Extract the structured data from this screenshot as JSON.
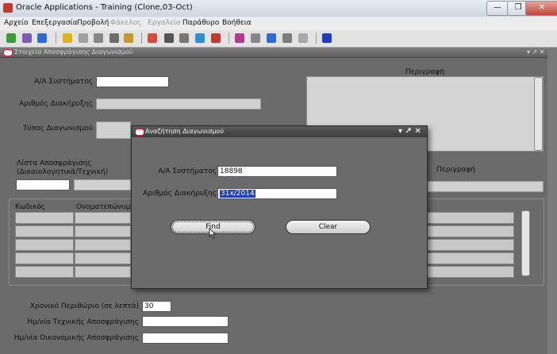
{
  "window": {
    "title": "Oracle Applications - Training (Clone,03-Oct)",
    "min_label": "—",
    "max_label": "❐",
    "close_label": "✕"
  },
  "menubar": {
    "items": [
      "Αρχείο",
      "Επεξεργασία",
      "Προβολή",
      "Φάκελος",
      "Εργαλεία",
      "Παράθυρο",
      "Βοήθεια"
    ]
  },
  "form": {
    "title": "Στοιχεία Αποσφράγισης Διαγωνισμού",
    "controls": "▾ ↗ ✕",
    "system_id_label": "Α/Α Συστήματος",
    "announcement_label": "Αριθμός Διακήρυξης",
    "type_label": "Τύπος Διαγωνισμού",
    "description_label": "Περιγραφή",
    "opening_list_label_1": "Λίστα Αποσφράγισης",
    "opening_list_label_2": "(Δικαιολογητικά/Τεχνική)",
    "description_label_2": "Περιγραφή",
    "table_headers": {
      "code": "Κωδικός",
      "name": "Ονοματεπώνυμο"
    },
    "time_margin_label": "Χρονικό Περιθώριο (σε λεπτά)",
    "time_margin_value": "30",
    "tech_opening_date_label": "Ημ/νία Τεχνικής Αποσφράγισης",
    "fin_opening_date_label": "Ημ/νία Οικονομικής Αποσφράγισης"
  },
  "dialog": {
    "title": "Αναζήτηση Διαγωνισμού",
    "controls": "▾ ↗ ✕",
    "system_id_label": "Α/Α Συστήματος",
    "system_id_value": "18898",
    "announcement_label": "Αριθμός Διακήρυξης",
    "announcement_value": "31x/2014",
    "find_label": "Find",
    "clear_label": "Clear"
  },
  "toolbar": {
    "icons": [
      "new-icon",
      "open-icon",
      "save-icon",
      "navigator-icon",
      "print-icon",
      "close-form-icon",
      "save-proceed-icon",
      "zoom-icon",
      "cut-icon",
      "copy-icon",
      "paste-icon",
      "new-record-icon",
      "delete-record-icon",
      "edit-field-icon",
      "zoom-record-icon",
      "translations-icon",
      "attachments-icon",
      "folder-tools-icon",
      "help-icon"
    ],
    "colors": [
      "#3a9d3a",
      "#7a5fb0",
      "#2f6ad1",
      "#e0b020",
      "#a0a0a0",
      "#888888",
      "#6d6d6d",
      "#c49b2e",
      "#d24b3f",
      "#555555",
      "#777777",
      "#2f8fd1",
      "#c0392b",
      "#b03a8a",
      "#888888",
      "#2f6ad1",
      "#7c7c7c",
      "#a8a8a8",
      "#1e3fb8"
    ]
  }
}
